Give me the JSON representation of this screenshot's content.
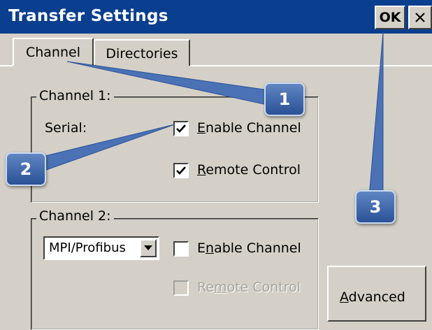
{
  "window": {
    "title": "Transfer Settings",
    "ok_label": "OK",
    "close_label": "×"
  },
  "tabs": [
    {
      "label": "Channel",
      "selected": true
    },
    {
      "label": "Directories",
      "selected": false
    }
  ],
  "channel1": {
    "group_label": "Channel 1:",
    "serial_label": "Serial:",
    "enable_channel": {
      "prefix": "",
      "mnemonic": "E",
      "suffix": "nable Channel",
      "checked": true
    },
    "remote_control": {
      "prefix": "",
      "mnemonic": "R",
      "suffix": "emote Control",
      "checked": true
    }
  },
  "channel2": {
    "group_label": "Channel 2:",
    "protocol_value": "MPI/Profibus",
    "enable_channel": {
      "prefix": "E",
      "mnemonic": "n",
      "suffix": "able Channel",
      "checked": false
    },
    "remote_control": {
      "prefix": "Re",
      "mnemonic": "m",
      "suffix": "ote Control",
      "checked": false,
      "disabled": true
    }
  },
  "advanced": {
    "prefix": "",
    "mnemonic": "A",
    "suffix": "dvanced"
  },
  "callouts": [
    "1",
    "2",
    "3"
  ],
  "colors": {
    "titlebar": "#0a3e8f",
    "window_bg": "#d4d0c8",
    "callout_fill": "#3f68ad"
  }
}
